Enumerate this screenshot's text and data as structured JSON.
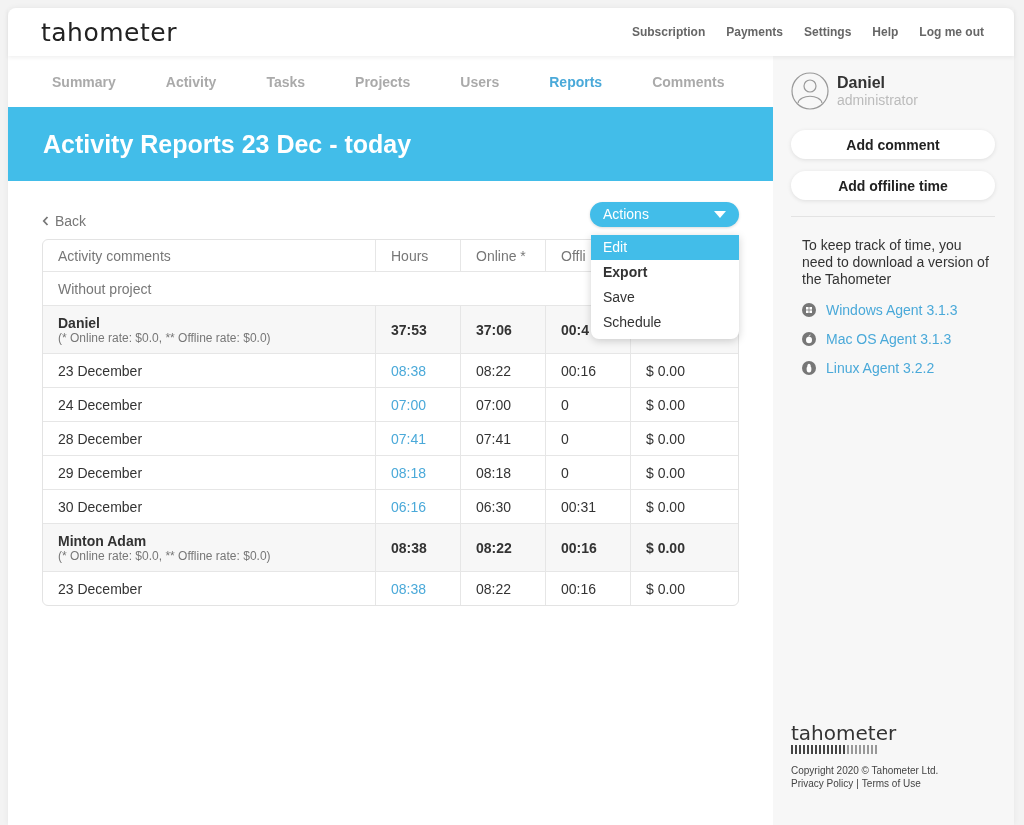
{
  "header": {
    "logo": "tahometer",
    "links": [
      "Subscription",
      "Payments",
      "Settings",
      "Help",
      "Log me out"
    ]
  },
  "tabs": [
    {
      "label": "Summary",
      "selected": false
    },
    {
      "label": "Activity",
      "selected": false
    },
    {
      "label": "Tasks",
      "selected": false
    },
    {
      "label": "Projects",
      "selected": false
    },
    {
      "label": "Users",
      "selected": false
    },
    {
      "label": "Reports",
      "selected": true
    },
    {
      "label": "Comments",
      "selected": false
    }
  ],
  "banner": {
    "title": "Activity Reports 23 Dec - today"
  },
  "back_link": "Back",
  "actions": {
    "label": "Actions",
    "expanded": true,
    "items": [
      {
        "label": "Edit",
        "selected": true,
        "bold": false
      },
      {
        "label": "Export",
        "selected": false,
        "bold": true
      },
      {
        "label": "Save",
        "selected": false,
        "bold": false
      },
      {
        "label": "Schedule",
        "selected": false,
        "bold": false
      }
    ]
  },
  "table": {
    "columns": [
      "Activity comments",
      "Hours",
      "Online *",
      "Offli"
    ],
    "rows": [
      {
        "kind": "section",
        "cells": [
          "Without project"
        ]
      },
      {
        "kind": "group",
        "cells": [
          "Daniel",
          "37:53",
          "37:06",
          "00:4"
        ],
        "note": "(* Online rate: $0.0, ** Offline rate: $0.0)"
      },
      {
        "kind": "day",
        "cells": [
          "23 December",
          "08:38",
          "08:22",
          "00:16",
          "$ 0.00"
        ]
      },
      {
        "kind": "day",
        "cells": [
          "24 December",
          "07:00",
          "07:00",
          "0",
          "$ 0.00"
        ]
      },
      {
        "kind": "day",
        "cells": [
          "28 December",
          "07:41",
          "07:41",
          "0",
          "$ 0.00"
        ]
      },
      {
        "kind": "day",
        "cells": [
          "29 December",
          "08:18",
          "08:18",
          "0",
          "$ 0.00"
        ]
      },
      {
        "kind": "day",
        "cells": [
          "30 December",
          "06:16",
          "06:30",
          "00:31",
          "$ 0.00"
        ]
      },
      {
        "kind": "group",
        "cells": [
          "Minton Adam",
          "08:38",
          "08:22",
          "00:16",
          "$ 0.00"
        ],
        "note": "(* Online rate: $0.0, ** Offline rate: $0.0)"
      },
      {
        "kind": "day",
        "cells": [
          "23 December",
          "08:38",
          "08:22",
          "00:16",
          "$ 0.00"
        ]
      }
    ]
  },
  "sidebar": {
    "user": {
      "name": "Daniel",
      "role": "administrator"
    },
    "buttons": [
      "Add comment",
      "Add offiline time"
    ],
    "download_text": "To keep track of time, you need to download a version of the Tahometer",
    "agents": [
      {
        "kind": "windows",
        "label": "Windows Agent 3.1.3"
      },
      {
        "kind": "mac",
        "label": "Mac OS Agent 3.1.3"
      },
      {
        "kind": "linux",
        "label": "Linux Agent 3.2.2"
      }
    ],
    "footer": {
      "logo": "tahometer",
      "copyright": "Copyright 2020 © Tahometer Ltd.",
      "links": [
        "Privacy Policy",
        "Terms of Use"
      ],
      "separator": "|"
    }
  }
}
